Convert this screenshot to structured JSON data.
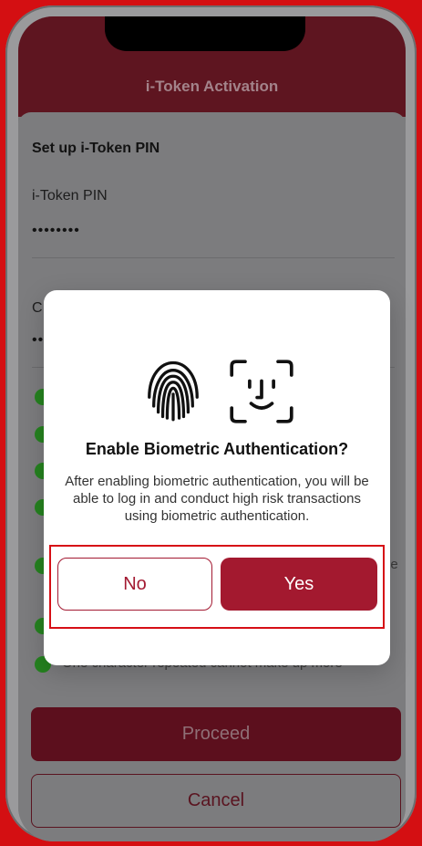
{
  "header": {
    "title": "i-Token Activation"
  },
  "form": {
    "section_title": "Set up i-Token PIN",
    "pin_label": "i-Token PIN",
    "pin_value": "••••••••",
    "confirm_label": "C",
    "confirm_value": "••",
    "rules": [
      {
        "text": "",
        "status": "check"
      },
      {
        "text": "",
        "status": "check"
      },
      {
        "text": "",
        "status": "check"
      },
      {
        "text": "",
        "status": "check"
      },
      {
        "text": "oe",
        "status": "check"
      },
      {
        "text": "",
        "status": "check"
      },
      {
        "text": "One character repeated cannot make up more",
        "status": "check"
      }
    ]
  },
  "dialog": {
    "title": "Enable Biometric Authentication?",
    "message": "After enabling biometric authentication, you will be able to log in and conduct high risk transactions using biometric authentication.",
    "no_label": "No",
    "yes_label": "Yes"
  },
  "buttons": {
    "proceed_label": "Proceed",
    "cancel_label": "Cancel"
  },
  "colors": {
    "brand": "#a3192f",
    "highlight": "#d60f16",
    "success": "#25821f"
  },
  "icons": {
    "fingerprint": "fingerprint-icon",
    "face_id": "face-id-icon",
    "check": "check-circle-icon"
  }
}
